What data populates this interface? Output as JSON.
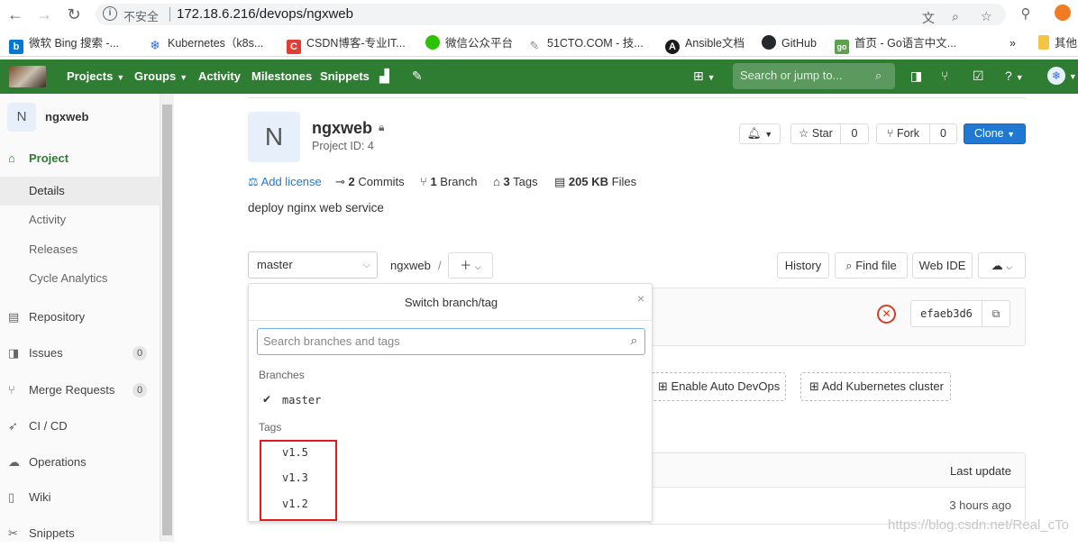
{
  "browser": {
    "insecure_label": "不安全",
    "url": "172.18.6.216/devops/ngxweb",
    "bookmarks": [
      {
        "label": "微软 Bing 搜索 -...",
        "icon": "bing-icon",
        "color": "#0078d7",
        "glyph": "b"
      },
      {
        "label": "Kubernetes（k8s...",
        "icon": "kubernetes-icon",
        "color": "#326ce5",
        "glyph": "❄"
      },
      {
        "label": "CSDN博客-专业IT...",
        "icon": "csdn-icon",
        "color": "#e33e33",
        "glyph": "C"
      },
      {
        "label": "微信公众平台",
        "icon": "wechat-icon",
        "color": "#2dc100",
        "glyph": "●"
      },
      {
        "label": "51CTO.COM - 技...",
        "icon": "51cto-icon",
        "color": "#888888",
        "glyph": "✎"
      },
      {
        "label": "Ansible文档",
        "icon": "ansible-icon",
        "color": "#1a1a1a",
        "glyph": "A"
      },
      {
        "label": "GitHub",
        "icon": "github-icon",
        "color": "#24292e",
        "glyph": "◉"
      },
      {
        "label": "首页 - Go语言中文...",
        "icon": "golang-icon",
        "color": "#5aa34a",
        "glyph": "go"
      }
    ],
    "more_bookmarks": "»",
    "other_bookmarks": "其他"
  },
  "header": {
    "nav": [
      "Projects",
      "Groups",
      "Activity",
      "Milestones",
      "Snippets"
    ],
    "search_placeholder": "Search or jump to..."
  },
  "sidebar": {
    "project_initial": "N",
    "project_name": "ngxweb",
    "project_label": "Project",
    "sub_items": [
      "Details",
      "Activity",
      "Releases",
      "Cycle Analytics"
    ],
    "items": [
      {
        "label": "Repository",
        "icon": "book-icon"
      },
      {
        "label": "Issues",
        "icon": "issues-icon",
        "badge": "0"
      },
      {
        "label": "Merge Requests",
        "icon": "merge-request-icon",
        "badge": "0"
      },
      {
        "label": "CI / CD",
        "icon": "rocket-icon"
      },
      {
        "label": "Operations",
        "icon": "cloud-gear-icon"
      },
      {
        "label": "Wiki",
        "icon": "wiki-icon"
      },
      {
        "label": "Snippets",
        "icon": "snippet-icon"
      }
    ]
  },
  "project": {
    "initial": "N",
    "name": "ngxweb",
    "id_label": "Project ID: 4",
    "star_label": "Star",
    "star_count": "0",
    "fork_label": "Fork",
    "fork_count": "0",
    "clone_label": "Clone",
    "add_license": "Add license",
    "commits_count": "2",
    "commits_label": "Commits",
    "branch_count": "1",
    "branch_label": "Branch",
    "tags_count": "3",
    "tags_label": "Tags",
    "files_size": "205 KB",
    "files_label": "Files",
    "description": "deploy nginx web service"
  },
  "repo": {
    "branch": "master",
    "breadcrumb": "ngxweb",
    "breadcrumb_sep": "/",
    "history": "History",
    "find_file": "Find file",
    "web_ide": "Web IDE",
    "commit_sha": "efaeb3d6",
    "auto_devops": "Enable Auto DevOps",
    "add_k8s": "Add Kubernetes cluster",
    "last_update_header": "Last update",
    "last_update_value": "3 hours ago"
  },
  "dropdown": {
    "title": "Switch branch/tag",
    "search_placeholder": "Search branches and tags",
    "branches_header": "Branches",
    "branches": [
      "master"
    ],
    "tags_header": "Tags",
    "tags": [
      "v1.5",
      "v1.3",
      "v1.2"
    ]
  },
  "watermark": "https://blog.csdn.net/Real_cTo",
  "colors": {
    "gitlab_header": "#2e7d32",
    "primary": "#1f78d1",
    "highlight": "#e3191b",
    "danger": "#db3b21"
  }
}
